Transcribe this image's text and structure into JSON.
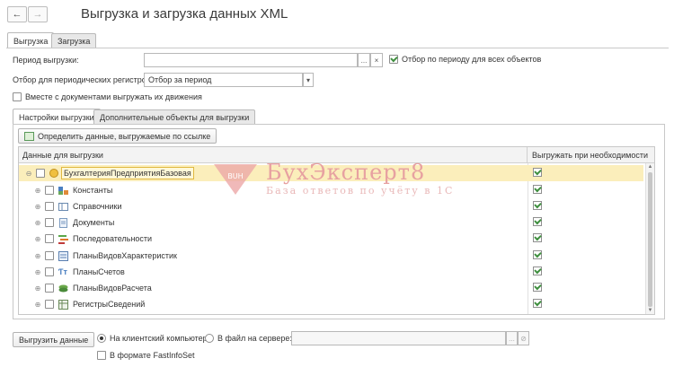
{
  "window": {
    "title": "Выгрузка и загрузка данных XML"
  },
  "tabs": [
    {
      "label": "Выгрузка",
      "active": true
    },
    {
      "label": "Загрузка",
      "active": false
    }
  ],
  "period": {
    "label": "Период выгрузки:",
    "value": "",
    "filter_all_label": "Отбор по периоду для всех объектов",
    "filter_all_checked": true
  },
  "periodic_registers": {
    "label": "Отбор для периодических регистров:",
    "value": "Отбор за период"
  },
  "with_movements": {
    "label": "Вместе с документами выгружать их движения",
    "checked": false
  },
  "inner_tabs": [
    {
      "label": "Настройки выгрузки",
      "active": true
    },
    {
      "label": "Дополнительные объекты для выгрузки",
      "active": false
    }
  ],
  "define_button": {
    "label": "Определить данные, выгружаемые по ссылке"
  },
  "grid": {
    "col_data": "Данные для выгрузки",
    "col_export": "Выгружать при необходимости",
    "rows": [
      {
        "label": "БухгалтерияПредприятияБазовая",
        "root": true,
        "icon": "config-icon",
        "export": true
      },
      {
        "label": "Константы",
        "icon": "constants-icon",
        "export": true
      },
      {
        "label": "Справочники",
        "icon": "catalogs-icon",
        "export": true
      },
      {
        "label": "Документы",
        "icon": "documents-icon",
        "export": true
      },
      {
        "label": "Последовательности",
        "icon": "sequences-icon",
        "export": true
      },
      {
        "label": "ПланыВидовХарактеристик",
        "icon": "characteristic-plans-icon",
        "export": true
      },
      {
        "label": "ПланыСчетов",
        "icon": "accounts-plans-icon",
        "export": true
      },
      {
        "label": "ПланыВидовРасчета",
        "icon": "calculation-plans-icon",
        "export": true
      },
      {
        "label": "РегистрыСведений",
        "icon": "info-registers-icon",
        "export": true
      }
    ]
  },
  "watermark": {
    "title": "БухЭксперт8",
    "subtitle": "База ответов по учёту в 1С"
  },
  "footer": {
    "export_button": "Выгрузить данные",
    "client_label": "На клиентский компьютер",
    "server_label": "В файл на сервере:",
    "server_value": "",
    "fastinfoset_label": "В формате FastInfoSet",
    "fastinfoset_checked": false
  },
  "colors": {
    "selection": "#fbeebb",
    "check": "#3f8f3f",
    "watermark": "#e7a1a1"
  }
}
